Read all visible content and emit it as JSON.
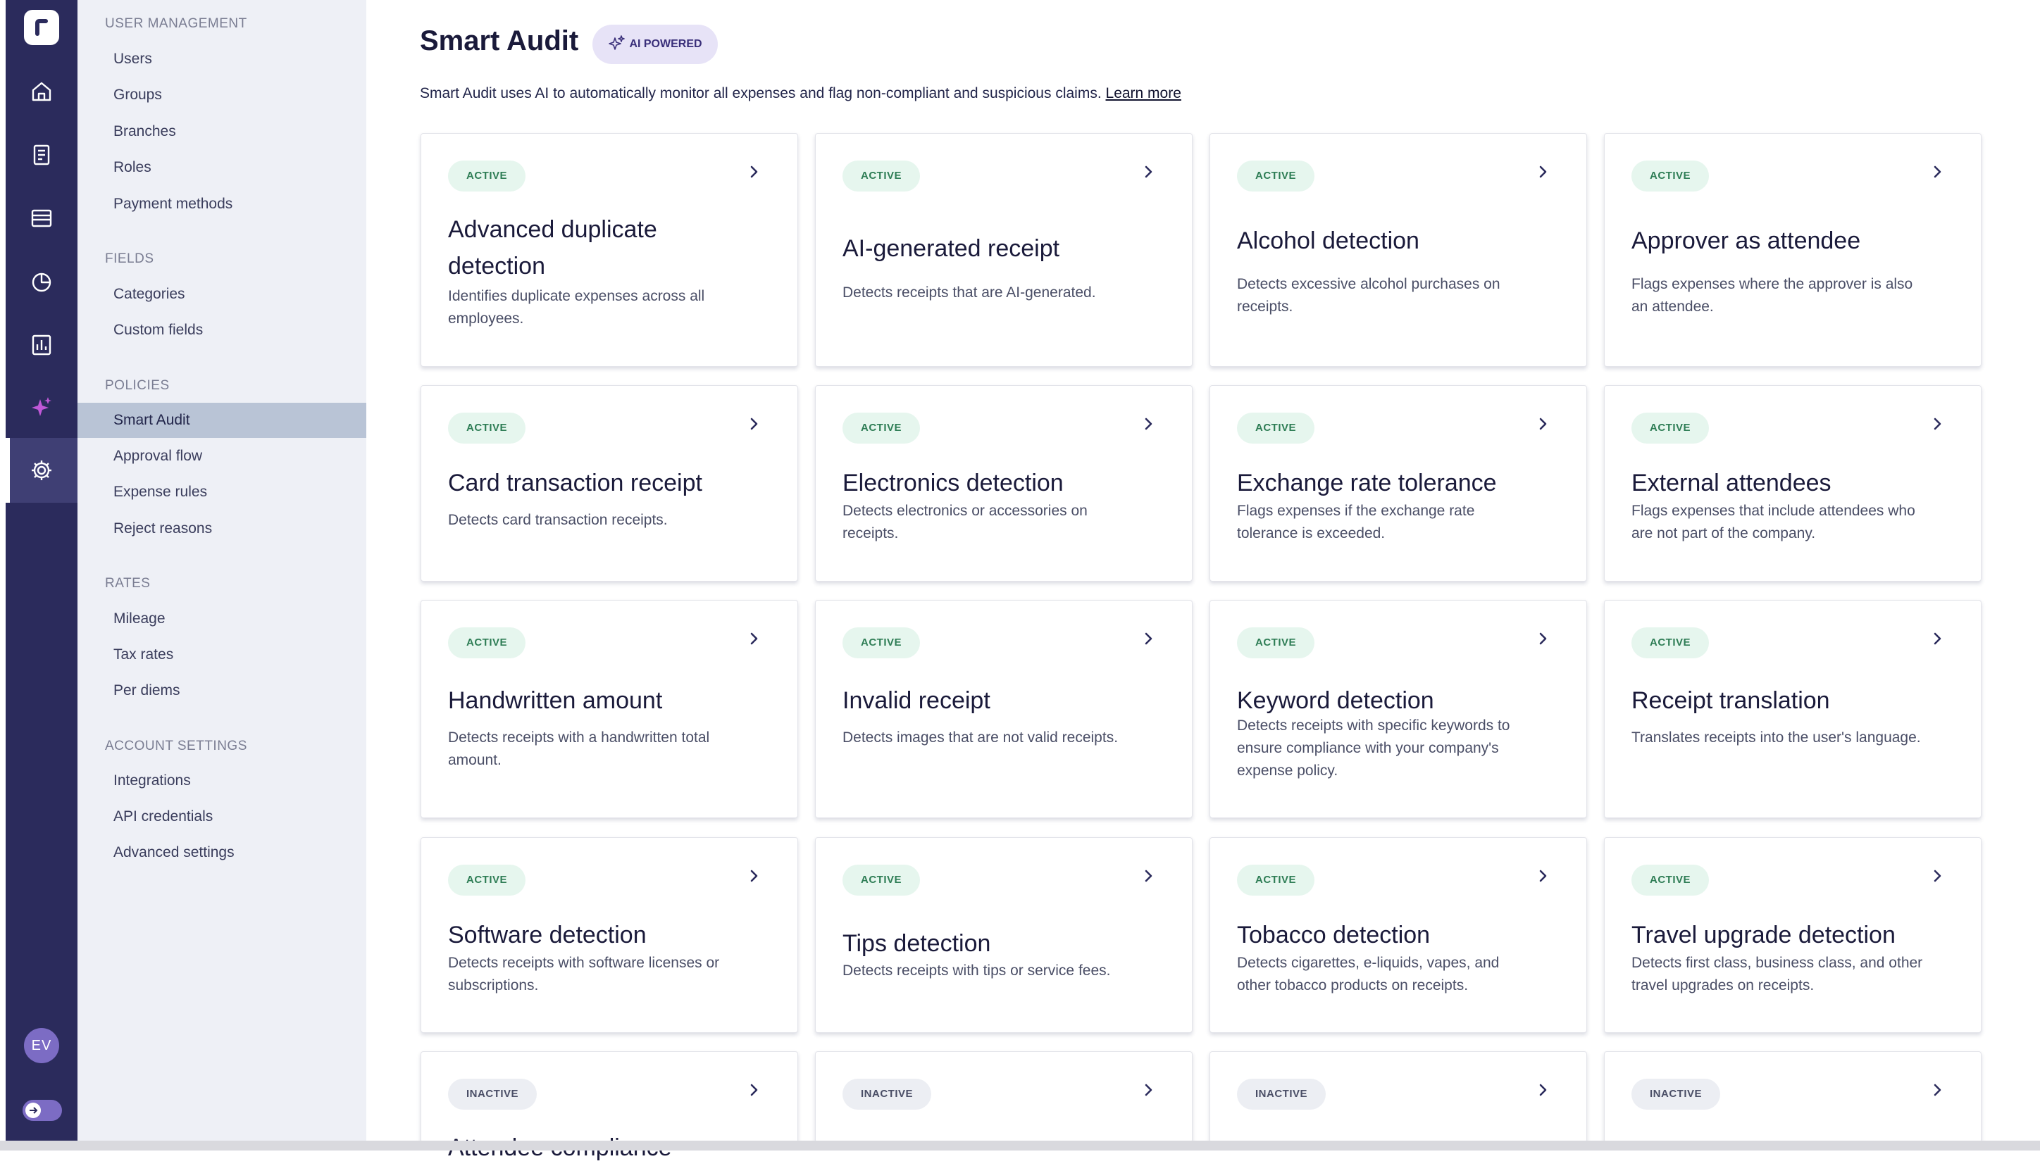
{
  "sidebar": {
    "sections": [
      {
        "heading": "USER MANAGEMENT",
        "items": [
          "Users",
          "Groups",
          "Branches",
          "Roles",
          "Payment methods"
        ]
      },
      {
        "heading": "FIELDS",
        "items": [
          "Categories",
          "Custom fields"
        ]
      },
      {
        "heading": "POLICIES",
        "items": [
          "Smart Audit",
          "Approval flow",
          "Expense rules",
          "Reject reasons"
        ]
      },
      {
        "heading": "RATES",
        "items": [
          "Mileage",
          "Tax rates",
          "Per diems"
        ]
      },
      {
        "heading": "ACCOUNT SETTINGS",
        "items": [
          "Integrations",
          "API credentials",
          "Advanced settings"
        ]
      }
    ],
    "active_item": "Smart Audit"
  },
  "rail": {
    "icons": [
      "logo-icon",
      "home-icon",
      "reports-icon",
      "cards-icon",
      "analytics-icon",
      "statistics-icon",
      "smart-audit-icon",
      "settings-icon"
    ],
    "active": "settings-icon",
    "avatar_initials": "EV"
  },
  "header": {
    "title": "Smart Audit",
    "badge": "AI POWERED",
    "intro": "Smart Audit uses AI to automatically monitor all expenses and flag non-compliant and suspicious claims.",
    "learn_more": "Learn more"
  },
  "cards": [
    {
      "status": "ACTIVE",
      "title": "Advanced duplicate detection",
      "desc": "Identifies duplicate expenses across all employees."
    },
    {
      "status": "ACTIVE",
      "title": "AI-generated receipt",
      "desc": "Detects receipts that are AI-generated."
    },
    {
      "status": "ACTIVE",
      "title": "Alcohol detection",
      "desc": "Detects excessive alcohol purchases on receipts."
    },
    {
      "status": "ACTIVE",
      "title": "Approver as attendee",
      "desc": "Flags expenses where the approver is also an attendee."
    },
    {
      "status": "ACTIVE",
      "title": "Card transaction receipt",
      "desc": "Detects card transaction receipts."
    },
    {
      "status": "ACTIVE",
      "title": "Electronics detection",
      "desc": "Detects electronics or accessories on receipts."
    },
    {
      "status": "ACTIVE",
      "title": "Exchange rate tolerance",
      "desc": "Flags expenses if the exchange rate tolerance is exceeded."
    },
    {
      "status": "ACTIVE",
      "title": "External attendees",
      "desc": "Flags expenses that include attendees who are not part of the company."
    },
    {
      "status": "ACTIVE",
      "title": "Handwritten amount",
      "desc": "Detects receipts with a handwritten total amount."
    },
    {
      "status": "ACTIVE",
      "title": "Invalid receipt",
      "desc": "Detects images that are not valid receipts."
    },
    {
      "status": "ACTIVE",
      "title": "Keyword detection",
      "desc": "Detects receipts with specific keywords to ensure compliance with your company's expense policy."
    },
    {
      "status": "ACTIVE",
      "title": "Receipt translation",
      "desc": "Translates receipts into the user's language."
    },
    {
      "status": "ACTIVE",
      "title": "Software detection",
      "desc": "Detects receipts with software licenses or subscriptions."
    },
    {
      "status": "ACTIVE",
      "title": "Tips detection",
      "desc": "Detects receipts with tips or service fees."
    },
    {
      "status": "ACTIVE",
      "title": "Tobacco detection",
      "desc": "Detects cigarettes, e-liquids, vapes, and other tobacco products on receipts."
    },
    {
      "status": "ACTIVE",
      "title": "Travel upgrade detection",
      "desc": "Detects first class, business class, and other travel upgrades on receipts."
    },
    {
      "status": "INACTIVE",
      "title": "Attendee compliance",
      "desc": ""
    },
    {
      "status": "INACTIVE",
      "title": "",
      "desc": ""
    },
    {
      "status": "INACTIVE",
      "title": "",
      "desc": ""
    },
    {
      "status": "INACTIVE",
      "title": "",
      "desc": ""
    }
  ],
  "colors": {
    "rail": "#2b2b5c",
    "accent": "#7c6cc4",
    "active_badge": "#2e7d55",
    "sidebar_active": "#b9c4d6"
  }
}
